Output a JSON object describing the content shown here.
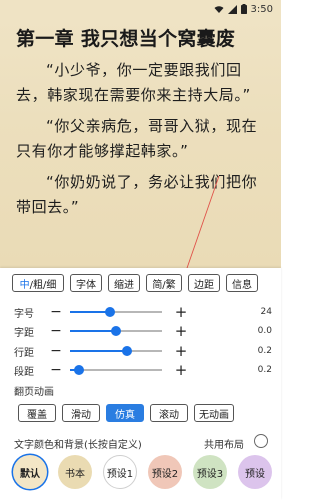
{
  "status_bar": {
    "time": "3:50",
    "icons": [
      "wifi-icon",
      "signal-icon",
      "battery-icon"
    ]
  },
  "reader": {
    "chapter_title": "第一章 我只想当个窝囊废",
    "paragraphs": [
      "“小少爷，你一定要跟我们回去，韩家现在需要你来主持大局。”",
      "“你父亲病危，哥哥入狱，现在只有你才能够撑起韩家。”",
      "“你奶奶说了，务必让我们把你带回去。”"
    ]
  },
  "toolbar": {
    "weight_active": "中",
    "weight_rest": "/粗/细",
    "buttons": [
      "字体",
      "缩进",
      "简/繁",
      "边距",
      "信息"
    ]
  },
  "sliders": [
    {
      "label": "字号",
      "value": "24",
      "level": 0.43
    },
    {
      "label": "字距",
      "value": "0.0",
      "level": 0.5
    },
    {
      "label": "行距",
      "value": "0.2",
      "level": 0.62
    },
    {
      "label": "段距",
      "value": "0.2",
      "level": 0.1
    }
  ],
  "page_anim": {
    "label": "翻页动画",
    "options": [
      "覆盖",
      "滑动",
      "仿真",
      "滚动",
      "无动画"
    ],
    "selected_index": 2
  },
  "color_section": {
    "label": "文字颜色和背景(长按自定义)",
    "shared_layout_label": "共用布局"
  },
  "presets": [
    {
      "label": "默认",
      "bg": "#f3e6c6",
      "selected": true
    },
    {
      "label": "书本",
      "bg": "#eadbb2",
      "selected": false
    },
    {
      "label": "预设1",
      "bg": "#ffffff",
      "selected": false
    },
    {
      "label": "预设2",
      "bg": "#f0c7b8",
      "selected": false
    },
    {
      "label": "预设3",
      "bg": "#cfe3c2",
      "selected": false
    },
    {
      "label": "预设",
      "bg": "#dcc4ec",
      "selected": false
    }
  ],
  "colors": {
    "accent": "#1a73e8",
    "paper": "#efe3c4",
    "pointer": "#e0534a"
  }
}
